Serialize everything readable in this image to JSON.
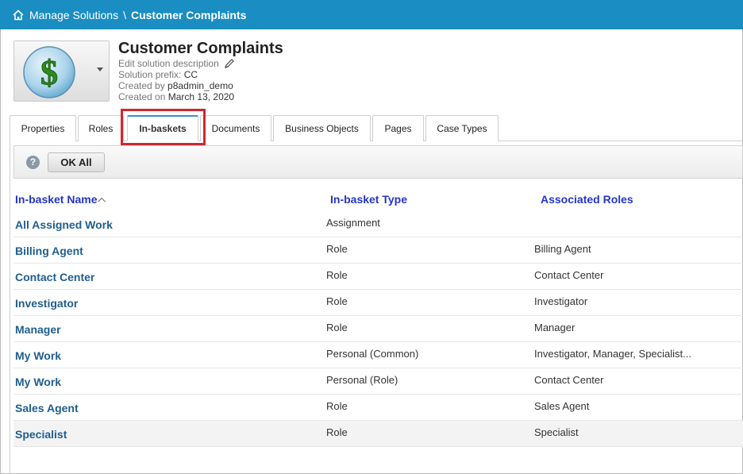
{
  "breadcrumb": {
    "parent": "Manage Solutions",
    "separator": "\\",
    "current": "Customer Complaints"
  },
  "solution": {
    "icon": "dollar-coin-icon",
    "title": "Customer Complaints",
    "edit_description": "Edit solution description",
    "prefix_label": "Solution prefix:",
    "prefix_value": "CC",
    "created_by_label": "Created by",
    "created_by_value": "p8admin_demo",
    "created_on_label": "Created on",
    "created_on_value": "March 13, 2020"
  },
  "tabs": [
    {
      "label": "Properties"
    },
    {
      "label": "Roles"
    },
    {
      "label": "In-baskets",
      "active": true
    },
    {
      "label": "Documents"
    },
    {
      "label": "Business Objects"
    },
    {
      "label": "Pages"
    },
    {
      "label": "Case Types"
    }
  ],
  "toolbar": {
    "help_icon": "question-icon",
    "ok_all_label": "OK All"
  },
  "grid": {
    "columns": {
      "name": "In-basket Name",
      "type": "In-basket Type",
      "roles": "Associated Roles"
    },
    "rows": [
      {
        "name": "All Assigned Work",
        "type": "Assignment",
        "roles": ""
      },
      {
        "name": "Billing Agent",
        "type": "Role",
        "roles": "Billing Agent"
      },
      {
        "name": "Contact Center",
        "type": "Role",
        "roles": "Contact Center"
      },
      {
        "name": "Investigator",
        "type": "Role",
        "roles": "Investigator"
      },
      {
        "name": "Manager",
        "type": "Role",
        "roles": "Manager"
      },
      {
        "name": "My Work",
        "type": "Personal (Common)",
        "roles": "Investigator, Manager, Specialist..."
      },
      {
        "name": "My Work",
        "type": "Personal (Role)",
        "roles": "Contact Center"
      },
      {
        "name": "Sales Agent",
        "type": "Role",
        "roles": "Sales Agent"
      },
      {
        "name": "Specialist",
        "type": "Role",
        "roles": "Specialist"
      }
    ]
  },
  "colors": {
    "topbar": "#1a8ec2",
    "highlight": "#d1262f",
    "link": "#1f5e8f",
    "column_header": "#2536c8"
  }
}
